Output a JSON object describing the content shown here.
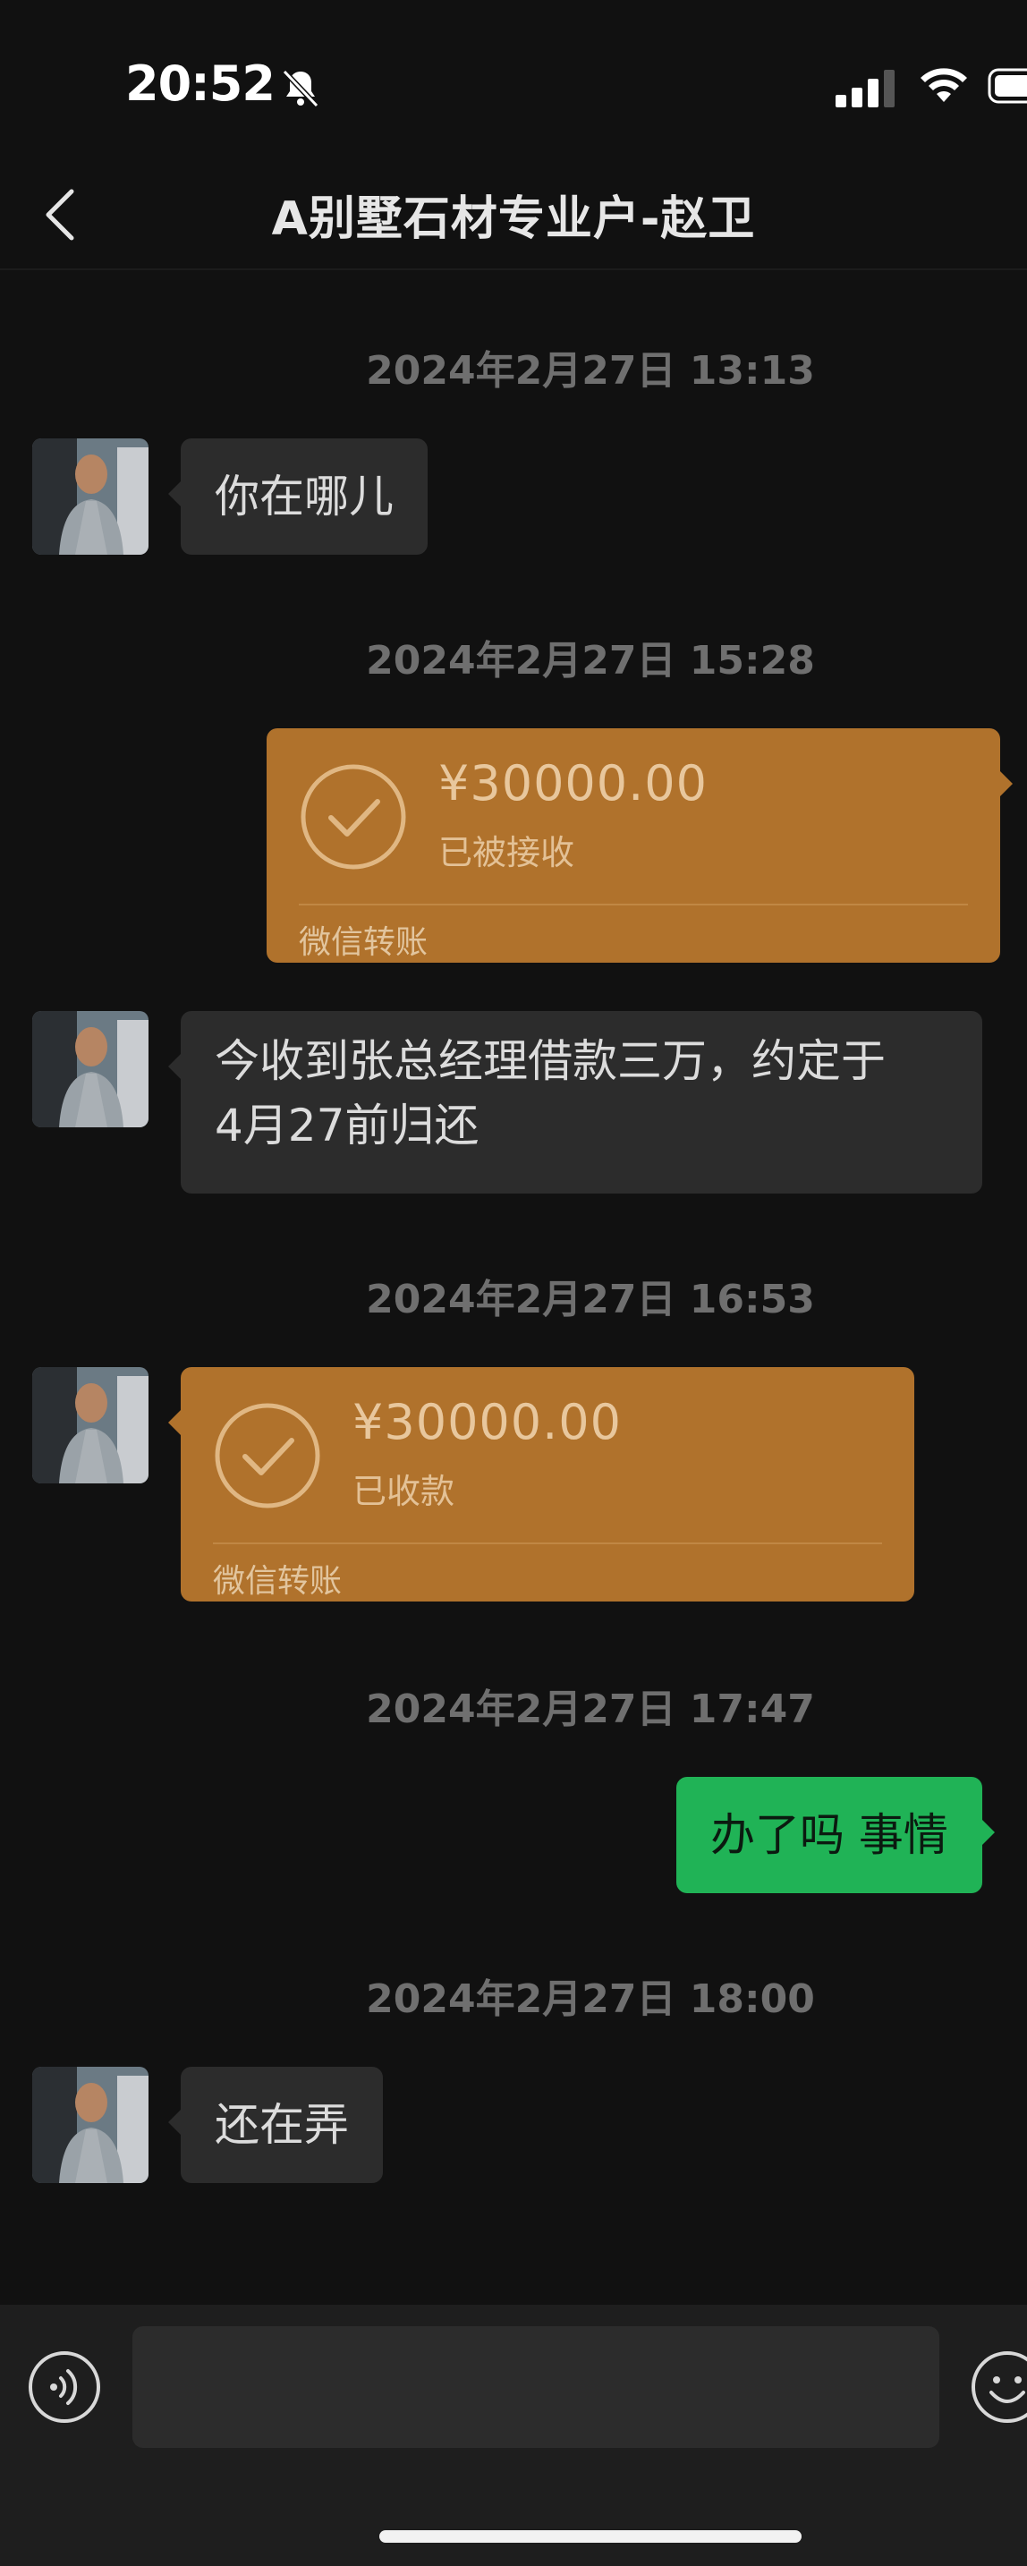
{
  "status_bar": {
    "time": "20:52"
  },
  "header": {
    "title": "A别墅石材专业户-赵卫"
  },
  "messages": [
    {
      "timestamp": "2024年2月27日 13:13",
      "direction": "in",
      "type": "text",
      "text": "你在哪儿"
    },
    {
      "timestamp": "2024年2月27日 15:28",
      "direction": "out",
      "type": "transfer",
      "amount": "¥30000.00",
      "status": "已被接收",
      "label": "微信转账"
    },
    {
      "direction": "in",
      "type": "text",
      "lines": [
        "今收到张总经理借款三万，约定于",
        "4月27前归还"
      ]
    },
    {
      "timestamp": "2024年2月27日 16:53",
      "direction": "in",
      "type": "transfer",
      "amount": "¥30000.00",
      "status": "已收款",
      "label": "微信转账"
    },
    {
      "timestamp": "2024年2月27日 17:47",
      "direction": "out",
      "type": "text",
      "text": "办了吗 事情"
    },
    {
      "timestamp": "2024年2月27日 18:00",
      "direction": "in",
      "type": "text",
      "text": "还在弄"
    }
  ],
  "input_bar": {
    "placeholder": ""
  },
  "icons": {
    "back": "chevron-left-icon",
    "mute": "bell-slash-icon",
    "signal": "cellular-signal-icon",
    "wifi": "wifi-icon",
    "battery": "battery-icon",
    "transfer": "checkmark-circle-icon",
    "voice": "voice-input-icon",
    "emoji": "emoji-icon"
  },
  "colors": {
    "background": "#111111",
    "incoming_bubble": "#2c2c2c",
    "outgoing_bubble": "#20b356",
    "transfer_card": "#b0722c",
    "timestamp_text": "#6f6f6f"
  }
}
